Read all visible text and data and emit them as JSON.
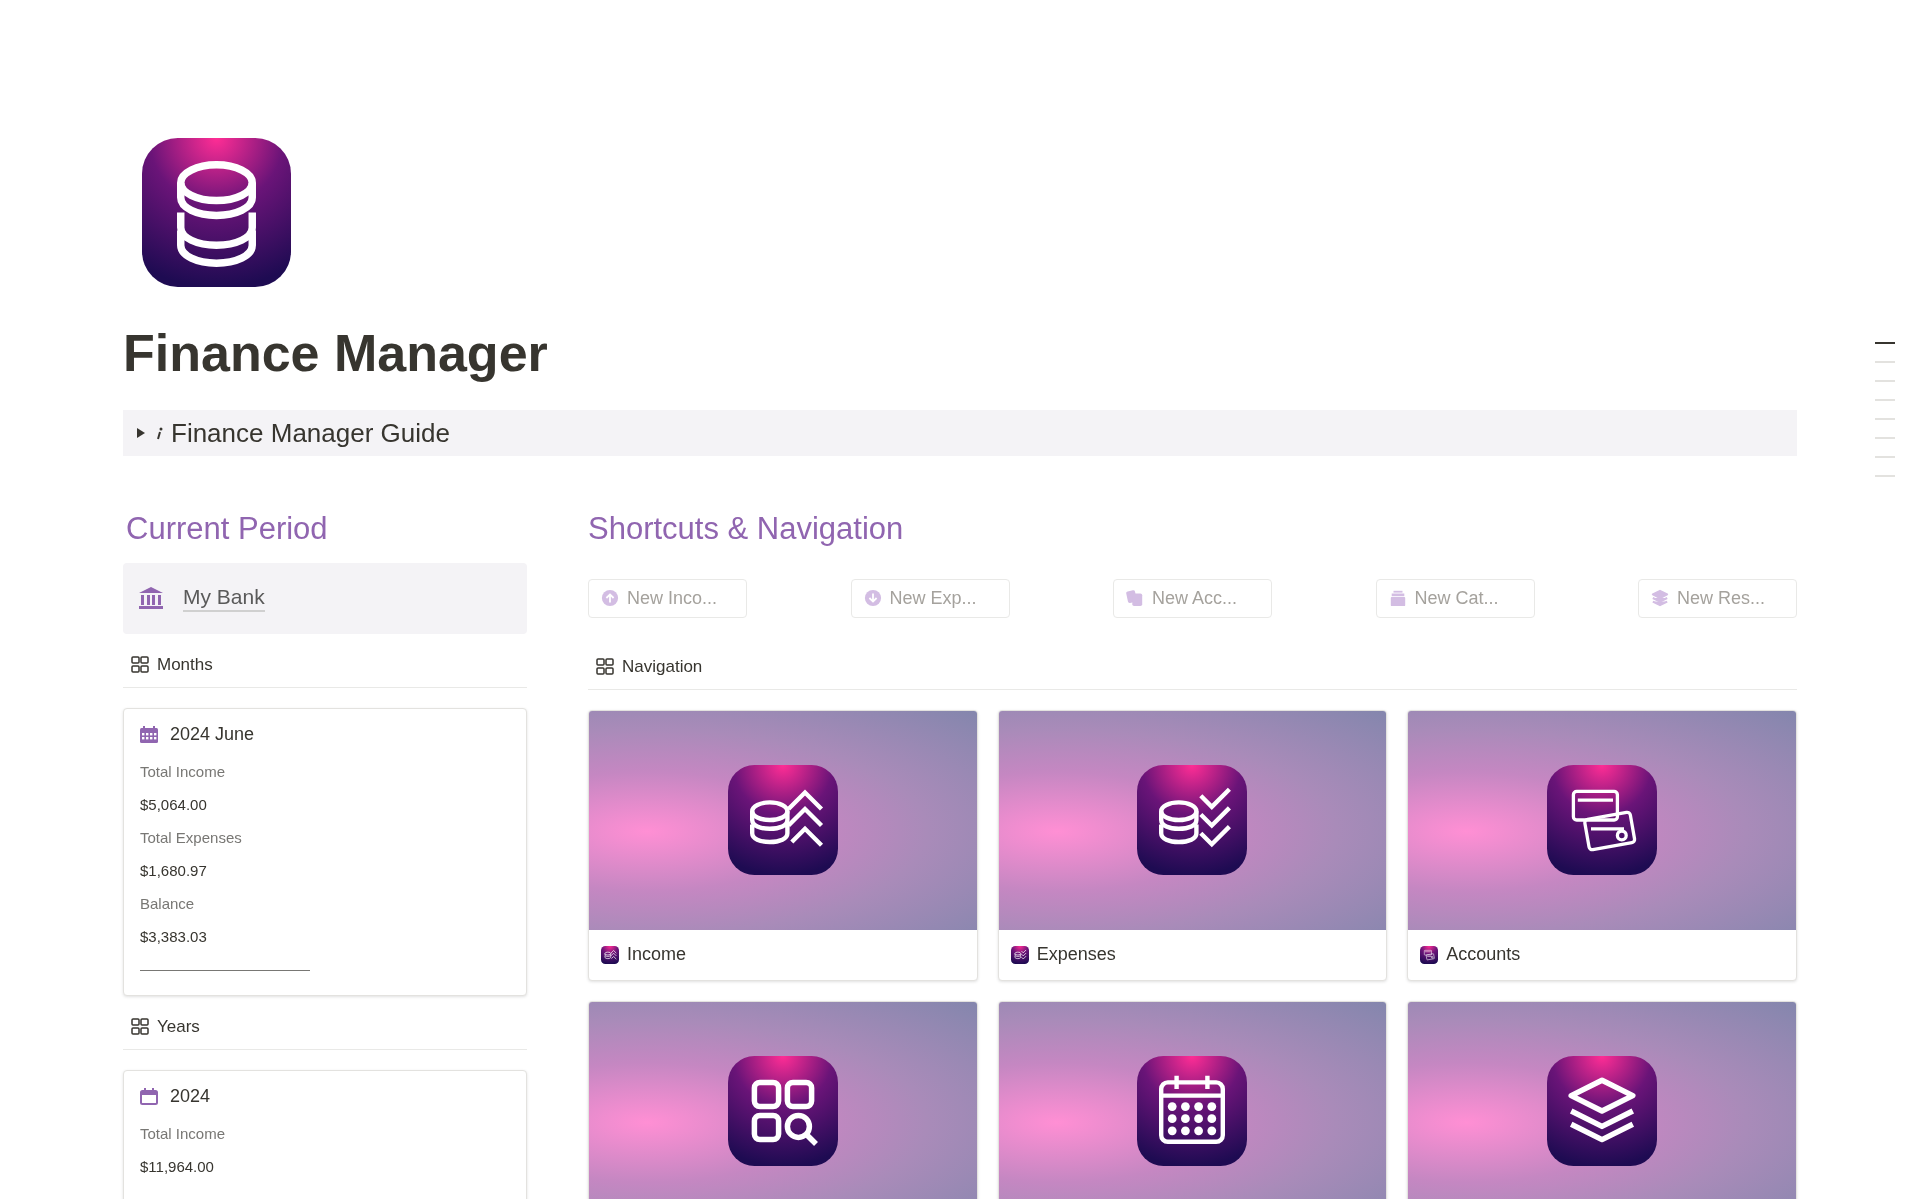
{
  "page": {
    "title": "Finance Manager"
  },
  "guide": {
    "title": "Finance Manager Guide",
    "expanded": false
  },
  "current_period": {
    "heading": "Current Period",
    "bank": "My Bank",
    "months": {
      "label": "Months",
      "cards": [
        {
          "title": "2024 June",
          "fields": [
            {
              "label": "Total Income",
              "value": "$5,064.00"
            },
            {
              "label": "Total Expenses",
              "value": "$1,680.97"
            },
            {
              "label": "Balance",
              "value": "$3,383.03"
            }
          ]
        }
      ]
    },
    "years": {
      "label": "Years",
      "cards": [
        {
          "title": "2024",
          "fields": [
            {
              "label": "Total Income",
              "value": "$11,964.00"
            }
          ]
        }
      ]
    }
  },
  "shortcuts": {
    "heading": "Shortcuts & Navigation",
    "buttons": [
      {
        "label": "New Inco...",
        "kind": "up"
      },
      {
        "label": "New Exp...",
        "kind": "down"
      },
      {
        "label": "New Acc...",
        "kind": "cards"
      },
      {
        "label": "New Cat...",
        "kind": "drawer"
      },
      {
        "label": "New Res...",
        "kind": "layers"
      }
    ],
    "navigation": {
      "label": "Navigation",
      "items": [
        {
          "label": "Income",
          "kind": "income"
        },
        {
          "label": "Expenses",
          "kind": "expenses"
        },
        {
          "label": "Accounts",
          "kind": "accounts"
        },
        {
          "kind": "grid"
        },
        {
          "kind": "calendar"
        },
        {
          "kind": "layers"
        }
      ]
    }
  }
}
